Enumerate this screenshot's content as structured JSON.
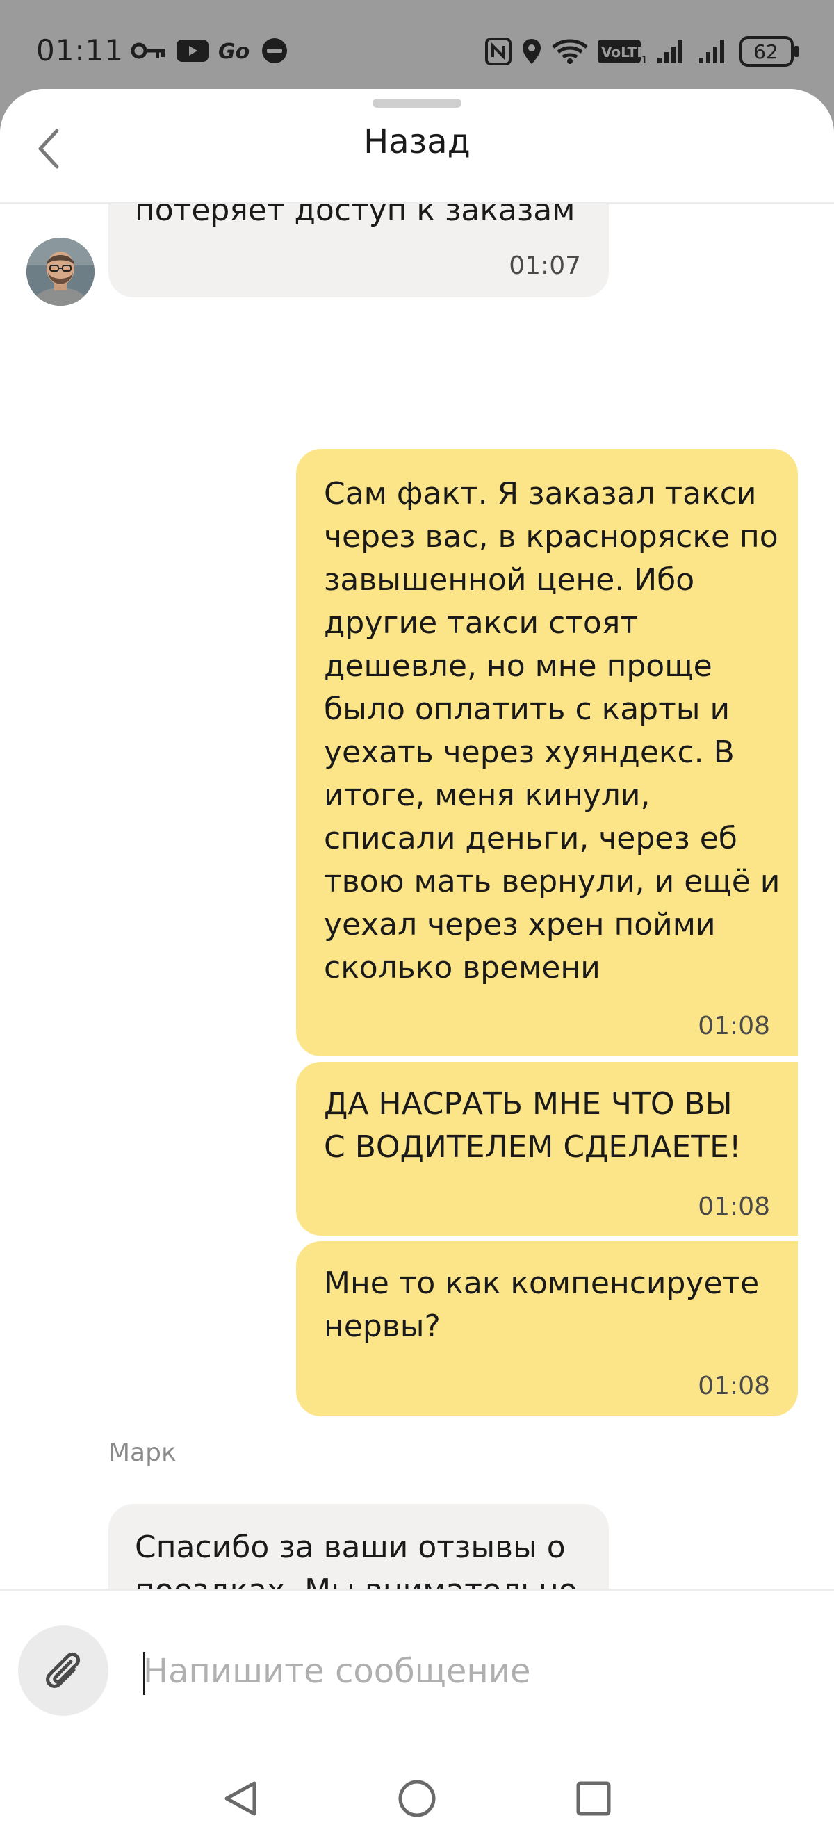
{
  "status_bar": {
    "time": "01:11",
    "battery_level": "62"
  },
  "header": {
    "back_label": "Назад"
  },
  "messages": [
    {
      "direction": "incoming",
      "text": "потеряет доступ к заказам",
      "time": "01:07"
    },
    {
      "direction": "outgoing",
      "text": "Сам факт. Я заказал такси\nчерез вас, в красноряске по\nзавышенной цене. Ибо\nдругие такси стоят\nдешевле, но мне проще\nбыло оплатить с карты и\nуехать через хуяндекс. В\nитоге, меня кинули,\nсписали деньги, через еб\nтвою мать вернули, и ещё и\nуехал через хрен пойми\nсколько времени",
      "time": "01:08"
    },
    {
      "direction": "outgoing",
      "text": "ДА НАСРАТЬ МНЕ ЧТО ВЫ\nС ВОДИТЕЛЕМ СДЕЛАЕТЕ!",
      "time": "01:08"
    },
    {
      "direction": "outgoing",
      "text": "Мне то как компенсируете\nнервы?",
      "time": "01:08"
    },
    {
      "direction": "incoming",
      "sender": "Марк",
      "text": "Спасибо за ваши отзывы о\nпоездках. Мы внимательно\nизучаем каждый из них и\nделаем всё возможное"
    }
  ],
  "input": {
    "placeholder": "Напишите сообщение",
    "value": ""
  },
  "colors": {
    "incoming_bubble": "#f2f1f0",
    "outgoing_bubble": "#fce589",
    "status_bar_bg": "#9b9b9b"
  }
}
